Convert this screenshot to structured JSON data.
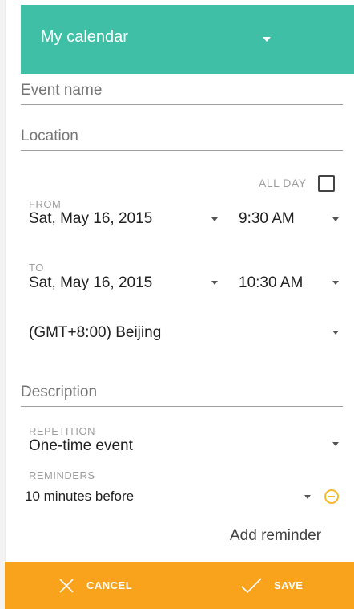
{
  "calendar": {
    "name": "My calendar"
  },
  "event_name": {
    "placeholder": "Event name"
  },
  "location": {
    "placeholder": "Location"
  },
  "all_day": {
    "label": "ALL DAY",
    "checked": false
  },
  "from": {
    "label": "FROM",
    "date": "Sat, May 16, 2015",
    "time": "9:30 AM"
  },
  "to": {
    "label": "TO",
    "date": "Sat, May 16, 2015",
    "time": "10:30 AM"
  },
  "timezone": {
    "value": "(GMT+8:00) Beijing"
  },
  "description": {
    "placeholder": "Description"
  },
  "repetition": {
    "label": "REPETITION",
    "value": "One-time event"
  },
  "reminders": {
    "label": "REMINDERS",
    "value": "10 minutes before"
  },
  "add_reminder": {
    "label": "Add reminder"
  },
  "actions": {
    "cancel": "CANCEL",
    "save": "SAVE"
  },
  "colors": {
    "accent": "#3fbfa6",
    "action_bar": "#f9a31d",
    "remove": "#f5b92a"
  }
}
